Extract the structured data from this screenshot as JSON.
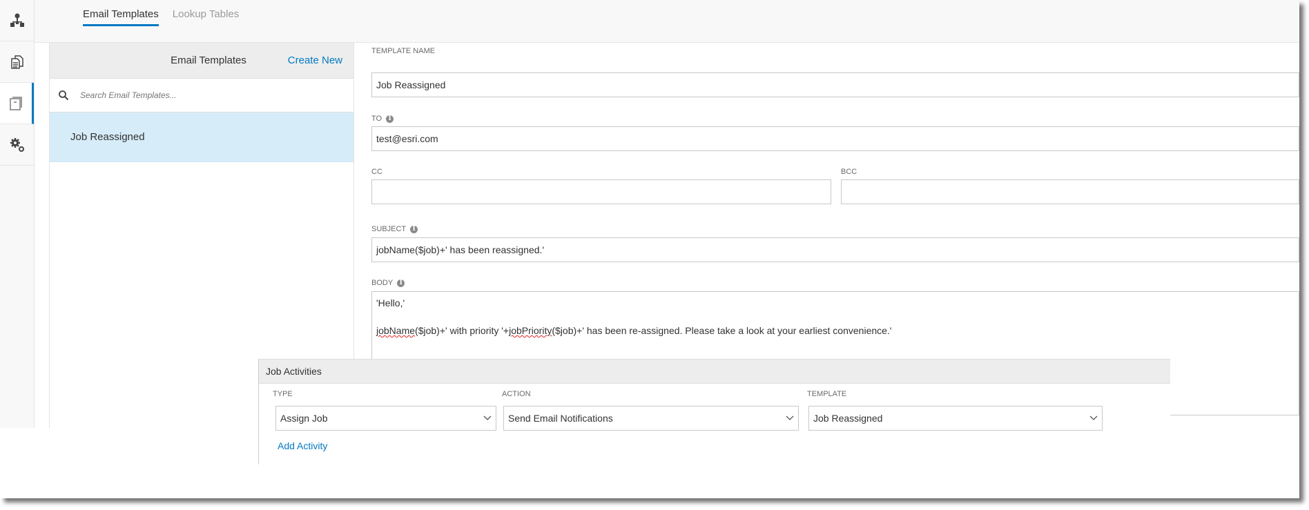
{
  "colors": {
    "accent": "#0079c1",
    "selected_row": "#d6ecf9",
    "header_bg": "#ededed"
  },
  "rail": {
    "items": [
      {
        "icon": "workflow-icon",
        "active": false
      },
      {
        "icon": "documents-icon",
        "active": false
      },
      {
        "icon": "template-icon",
        "active": true
      },
      {
        "icon": "settings-icon",
        "active": false
      }
    ]
  },
  "tabs": [
    {
      "label": "Email Templates",
      "active": true
    },
    {
      "label": "Lookup Tables",
      "active": false
    }
  ],
  "left_panel": {
    "title": "Email Templates",
    "create_new": "Create New",
    "search_placeholder": "Search Email Templates...",
    "items": [
      {
        "label": "Job Reassigned",
        "selected": true
      }
    ]
  },
  "form": {
    "template_name_label": "Template Name",
    "template_name_value": "Job Reassigned",
    "to_label": "To",
    "to_value": "test@esri.com",
    "cc_label": "CC",
    "cc_value": "",
    "bcc_label": "BCC",
    "bcc_value": "",
    "subject_label": "Subject",
    "subject_value": "jobName($job)+' has been reassigned.'",
    "body_label": "Body",
    "body_line1": "'Hello,'",
    "body_line2_a": "jobName",
    "body_line2_b": "($job)+' with priority '+",
    "body_line2_c": "jobPriority",
    "body_line2_d": "($job)+' has been re-assigned. Please take a look at your earliest convenience.'"
  },
  "activities": {
    "title": "Job Activities",
    "type_label": "TYPE",
    "action_label": "ACTION",
    "template_label": "TEMPLATE",
    "type_value": "Assign Job",
    "action_value": "Send Email Notifications",
    "template_value": "Job Reassigned",
    "add_activity": "Add Activity"
  }
}
